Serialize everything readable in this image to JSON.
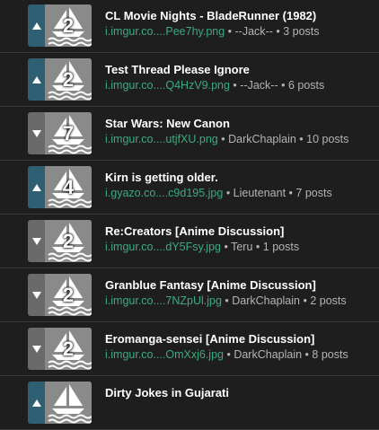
{
  "threads": [
    {
      "title": "CL Movie Nights - BladeRunner (1982)",
      "link": "i.imgur.co....Pee7hy.png",
      "author": "--Jack--",
      "posts": "3 posts",
      "count": "2",
      "vote": "up"
    },
    {
      "title": "Test Thread Please Ignore",
      "link": "i.imgur.co....Q4HzV9.png",
      "author": "--Jack--",
      "posts": "6 posts",
      "count": "2",
      "vote": "up"
    },
    {
      "title": "Star Wars: New Canon",
      "link": "i.imgur.co....utjfXU.png",
      "author": "DarkChaplain",
      "posts": "10 posts",
      "count": "7",
      "vote": "down"
    },
    {
      "title": "Kirn is getting older.",
      "link": "i.gyazo.co....c9d195.jpg",
      "author": "Lieutenant",
      "posts": "7 posts",
      "count": "4",
      "vote": "up"
    },
    {
      "title": "Re:Creators [Anime Discussion]",
      "link": "i.imgur.co....dY5Fsy.jpg",
      "author": "Teru",
      "posts": "1 posts",
      "count": "2",
      "vote": "down"
    },
    {
      "title": "Granblue Fantasy [Anime Discussion]",
      "link": "i.imgur.co....7NZpUl.jpg",
      "author": "DarkChaplain",
      "posts": "2 posts",
      "count": "2",
      "vote": "down"
    },
    {
      "title": "Eromanga-sensei [Anime Discussion]",
      "link": "i.imgur.co....OmXxj6.jpg",
      "author": "DarkChaplain",
      "posts": "8 posts",
      "count": "2",
      "vote": "down"
    },
    {
      "title": "Dirty Jokes in Gujarati",
      "link": "",
      "author": "",
      "posts": "",
      "count": "",
      "vote": "up"
    }
  ],
  "separator": " • ",
  "icons": {
    "vote_up": "triangle-up-icon",
    "vote_down": "triangle-down-icon",
    "thumb": "sailboat-icon"
  },
  "colors": {
    "background": "#1e1e1e",
    "link": "#3daa80",
    "vote_up": "#2f5f73",
    "vote_down": "#6a6a6a",
    "thumb": "#8a8a8a"
  }
}
